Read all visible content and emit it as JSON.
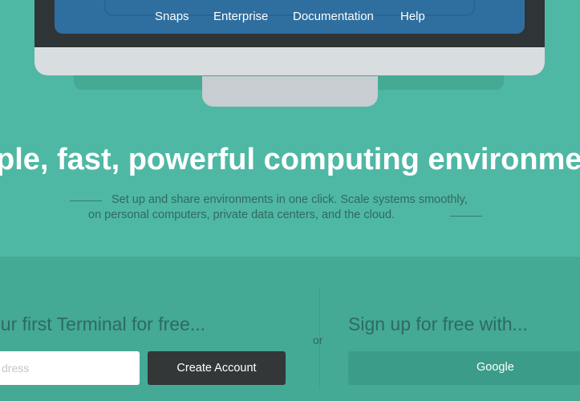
{
  "nav": {
    "items": [
      {
        "label": "Snaps"
      },
      {
        "label": "Enterprise"
      },
      {
        "label": "Documentation"
      },
      {
        "label": "Help"
      }
    ]
  },
  "hero": {
    "title": "ple, fast, powerful computing environme",
    "tagline_line1": "Set up and share environments in one click. Scale systems smoothly,",
    "tagline_line2": "on personal computers, private data centers, and the cloud."
  },
  "signup": {
    "left_title": "our first Terminal for free...",
    "email_placeholder": "dress",
    "create_account_label": "Create Account",
    "or_label": "or",
    "right_title": "Sign up for free with...",
    "google_label": "Google"
  },
  "colors": {
    "background": "#4fb8a4",
    "band": "#44a995",
    "dark_button": "#333738",
    "google_button": "#3b9d89",
    "screen_blue": "#2f6fa0"
  }
}
